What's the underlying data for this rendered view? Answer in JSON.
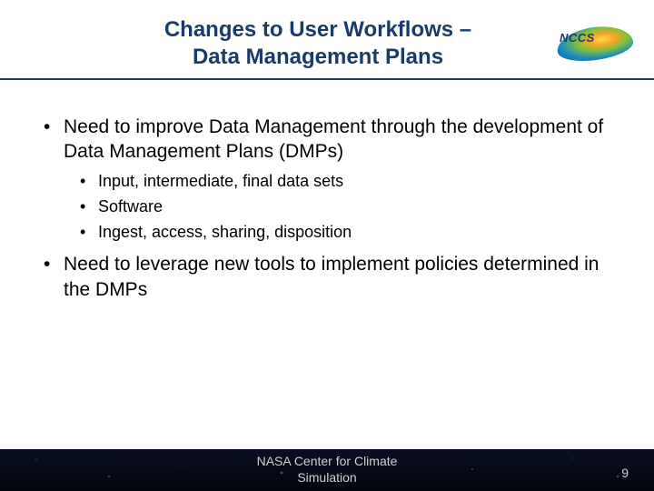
{
  "header": {
    "title_line1": "Changes to User Workflows –",
    "title_line2": "Data Management Plans",
    "logo_text": "NCCS"
  },
  "bullets": {
    "main1": "Need to improve Data Management through the development of Data Management Plans (DMPs)",
    "sub1": "Input, intermediate, final data sets",
    "sub2": "Software",
    "sub3": "Ingest, access, sharing, disposition",
    "main2": "Need to leverage new tools to implement policies determined in the DMPs"
  },
  "footer": {
    "org": "NASA Center for Climate Simulation",
    "page": "9"
  }
}
